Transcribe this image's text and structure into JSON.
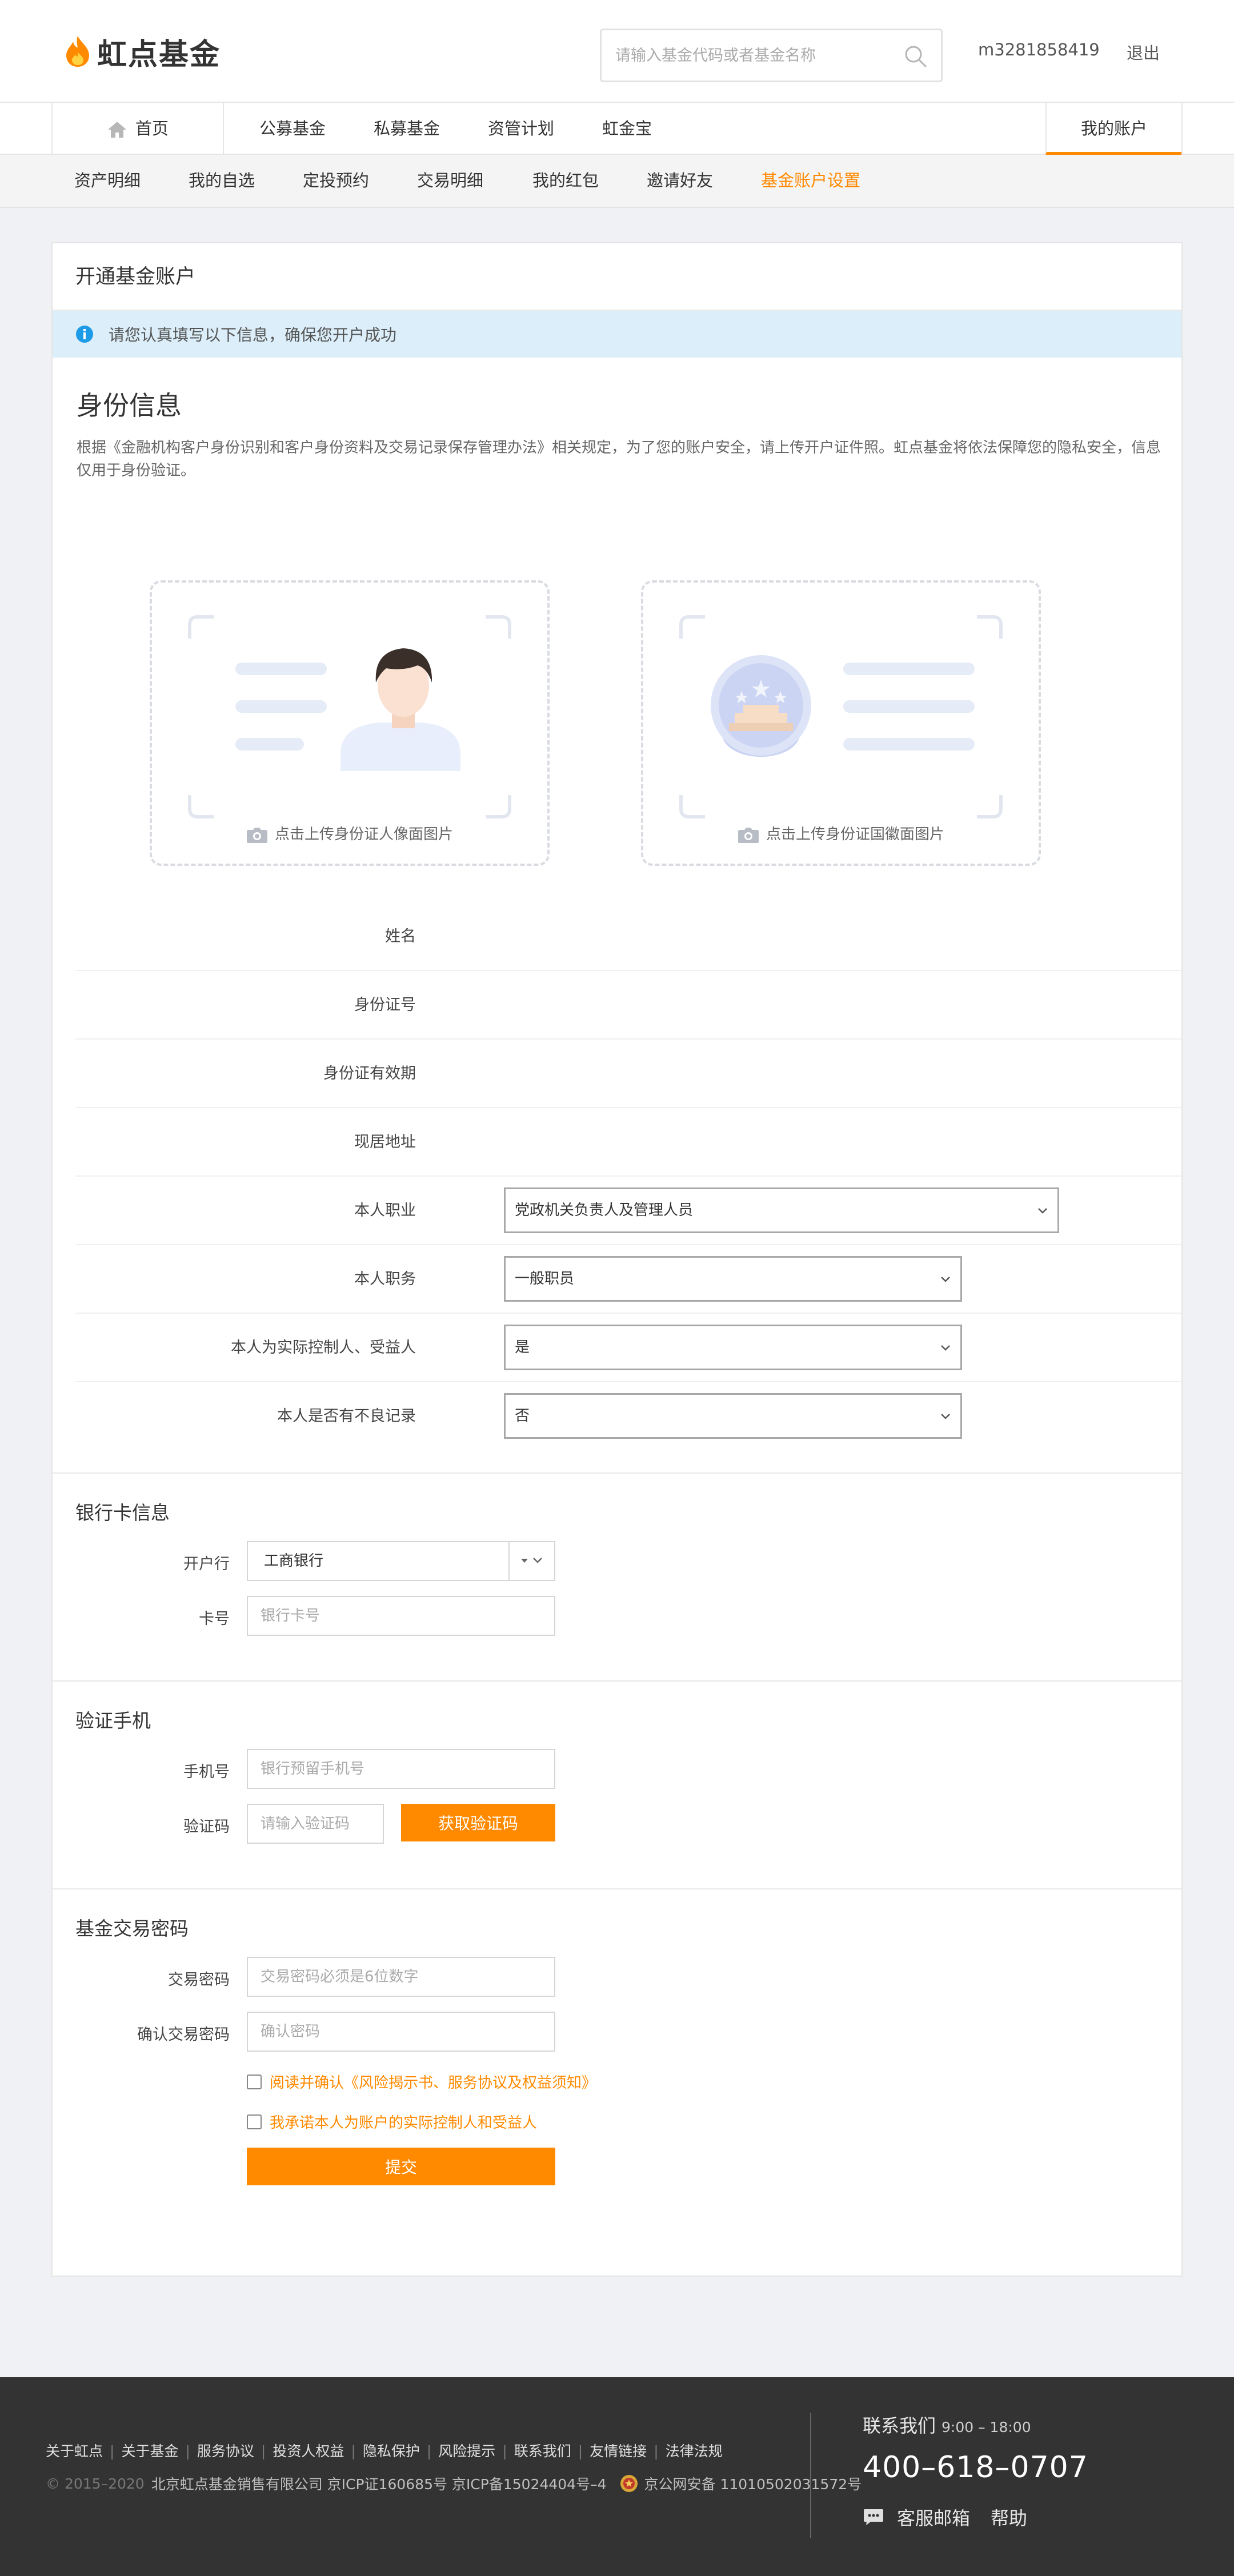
{
  "header": {
    "logo_text": "虹点基金",
    "search_placeholder": "请输入基金代码或者基金名称",
    "username": "m3281858419",
    "logout_label": "退出"
  },
  "main_nav": {
    "items": [
      "首页",
      "公募基金",
      "私募基金",
      "资管计划",
      "虹金宝"
    ],
    "account_label": "我的账户"
  },
  "sub_nav": {
    "items": [
      "资产明细",
      "我的自选",
      "定投预约",
      "交易明细",
      "我的红包",
      "邀请好友",
      "基金账户设置"
    ],
    "active_index": 6
  },
  "card": {
    "title": "开通基金账户",
    "notice": "请您认真填写以下信息，确保您开户成功"
  },
  "identity": {
    "title": "身份信息",
    "description": "根据《金融机构客户身份识别和客户身份资料及交易记录保存管理办法》相关规定，为了您的账户安全，请上传开户证件照。虹点基金将依法保障您的隐私安全，信息仅用于身份验证。",
    "upload_front": "点击上传身份证人像面图片",
    "upload_back": "点击上传身份证国徽面图片",
    "fields": [
      {
        "label": "姓名"
      },
      {
        "label": "身份证号"
      },
      {
        "label": "身份证有效期"
      },
      {
        "label": "现居地址"
      }
    ],
    "occupation_label": "本人职业",
    "occupation_value": "党政机关负责人及管理人员",
    "position_label": "本人职务",
    "position_value": "一般职员",
    "controller_label": "本人为实际控制人、受益人",
    "controller_value": "是",
    "record_label": "本人是否有不良记录",
    "record_value": "否"
  },
  "bank": {
    "title": "银行卡信息",
    "bank_label": "开户行",
    "bank_value": "工商银行",
    "card_label": "卡号",
    "card_placeholder": "银行卡号"
  },
  "phone_verify": {
    "title": "验证手机",
    "phone_label": "手机号",
    "phone_placeholder": "银行预留手机号",
    "code_label": "验证码",
    "code_placeholder": "请输入验证码",
    "code_button": "获取验证码"
  },
  "password": {
    "title": "基金交易密码",
    "pwd_label": "交易密码",
    "pwd_placeholder": "交易密码必须是6位数字",
    "confirm_label": "确认交易密码",
    "confirm_placeholder": "确认密码",
    "agree1": "阅读并确认《风险揭示书、服务协议及权益须知》",
    "agree2": "我承诺本人为账户的实际控制人和受益人",
    "submit": "提交"
  },
  "footer": {
    "links": [
      "关于虹点",
      "关于基金",
      "服务协议",
      "投资人权益",
      "隐私保护",
      "风险提示",
      "联系我们",
      "友情链接",
      "法律法规"
    ],
    "copyright": "© 2015–2020",
    "company": "北京虹点基金销售有限公司 京ICP证160685号 京ICP备15024404号–4",
    "police": "京公网安备 11010502031572号",
    "contact_label": "联系我们",
    "hours": "9:00 – 18:00",
    "phone": "400–618–0707",
    "email_label": "客服邮箱",
    "help_label": "帮助"
  },
  "colors": {
    "accent": "#ff8a00",
    "notice_bg": "#dbeef9",
    "footer_bg": "#333333",
    "page_bg": "#eff1f4"
  }
}
